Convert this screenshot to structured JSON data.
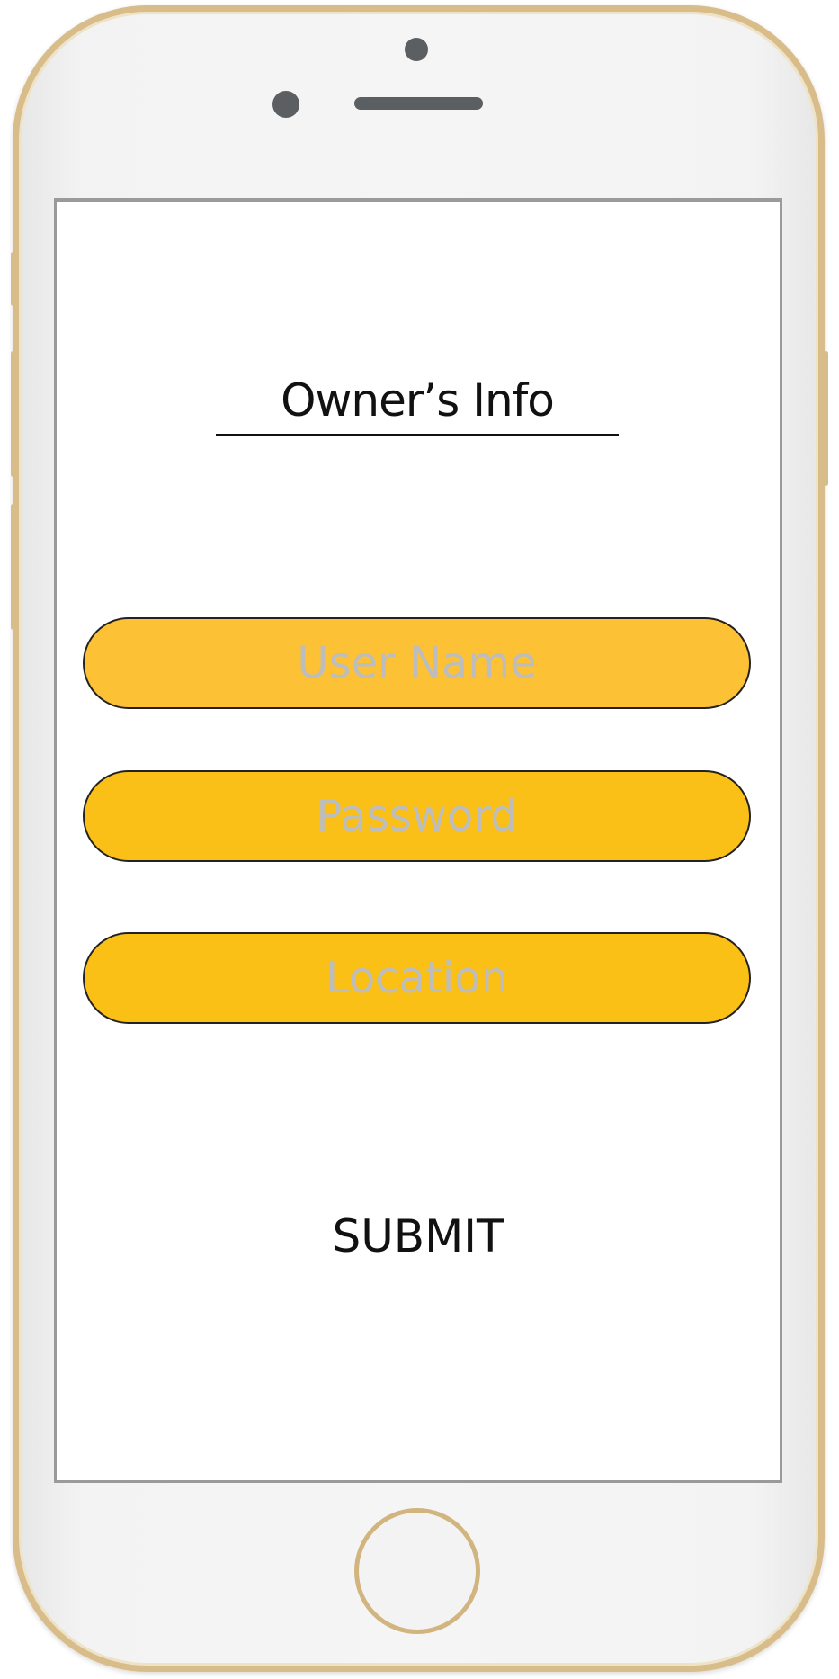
{
  "screen": {
    "title": "Owner’s Info",
    "fields": [
      {
        "placeholder": "User Name",
        "value": ""
      },
      {
        "placeholder": "Password",
        "value": ""
      },
      {
        "placeholder": "Location",
        "value": ""
      }
    ],
    "submit_label": "SUBMIT"
  },
  "colors": {
    "field_fill": "#fbc018",
    "placeholder": "#bdbdbd",
    "phone_frame": "#d8bd8a",
    "text": "#111111"
  }
}
